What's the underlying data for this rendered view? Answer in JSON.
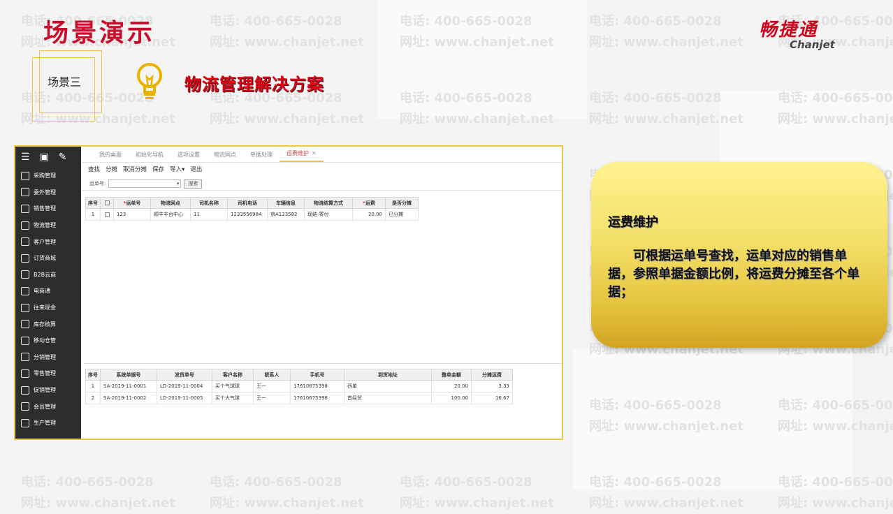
{
  "slide": {
    "title": "场景演示",
    "scene_label": "场景三",
    "subtitle": "物流管理解决方案"
  },
  "logo": {
    "cn": "畅捷通",
    "en": "Chanjet"
  },
  "watermark": {
    "phone": "电话: 400-665-0028",
    "web": "网址: www.chanjet.net"
  },
  "app": {
    "sidebar": {
      "top_icons": [
        "menu-icon",
        "document-icon",
        "edit-icon"
      ],
      "items": [
        {
          "label": "采购管理",
          "icon": "purchase-icon"
        },
        {
          "label": "委外管理",
          "icon": "outsource-icon"
        },
        {
          "label": "销售管理",
          "icon": "sales-icon"
        },
        {
          "label": "物流管理",
          "icon": "logistics-icon"
        },
        {
          "label": "客户管理",
          "icon": "customer-icon"
        },
        {
          "label": "订货商城",
          "icon": "mall-icon"
        },
        {
          "label": "B2B云商",
          "icon": "b2b-icon"
        },
        {
          "label": "电商通",
          "icon": "ecommerce-icon"
        },
        {
          "label": "往来现金",
          "icon": "cash-icon"
        },
        {
          "label": "库存核算",
          "icon": "inventory-icon"
        },
        {
          "label": "移动仓管",
          "icon": "warehouse-icon"
        },
        {
          "label": "分销管理",
          "icon": "distribution-icon"
        },
        {
          "label": "零售管理",
          "icon": "retail-icon"
        },
        {
          "label": "促销管理",
          "icon": "promotion-icon"
        },
        {
          "label": "会员管理",
          "icon": "member-icon"
        },
        {
          "label": "生产管理",
          "icon": "production-icon"
        }
      ]
    },
    "tabs": [
      {
        "label": "我的桌面",
        "active": false
      },
      {
        "label": "初始化导航",
        "active": false
      },
      {
        "label": "选项设置",
        "active": false
      },
      {
        "label": "物流网点",
        "active": false
      },
      {
        "label": "单据处理",
        "active": false
      },
      {
        "label": "运费维护",
        "active": true
      }
    ],
    "toolbar": [
      "查找",
      "分摊",
      "取消分摊",
      "保存",
      "导入",
      "退出"
    ],
    "search": {
      "label": "运单号:",
      "button": "搜索"
    },
    "top_table": {
      "headers": [
        "序号",
        "",
        "运单号",
        "物流网点",
        "司机名称",
        "司机电话",
        "车辆信息",
        "物流结算方式",
        "运费",
        "是否分摊"
      ],
      "required": [
        false,
        false,
        true,
        false,
        false,
        false,
        false,
        false,
        true,
        false
      ],
      "rows": [
        [
          "1",
          "",
          "123",
          "顺丰丰台中心",
          "11",
          "1233556984",
          "京A123582",
          "现结-寄付",
          "20.00",
          "已分摊"
        ]
      ]
    },
    "bottom_table": {
      "headers": [
        "序号",
        "系统单据号",
        "发货单号",
        "客户名称",
        "联系人",
        "手机号",
        "到货地址",
        "整单金额",
        "分摊运费"
      ],
      "rows": [
        [
          "1",
          "SA-2019-11-0001",
          "LD-2019-11-0004",
          "买个气球球",
          "王一",
          "17610675398",
          "西单",
          "20.00",
          "3.33"
        ],
        [
          "2",
          "SA-2019-11-0002",
          "LD-2019-11-0005",
          "买个大气球",
          "王一",
          "17610675398",
          "首经贸",
          "100.00",
          "16.67"
        ]
      ]
    }
  },
  "card": {
    "title": "运费维护",
    "body": "可根据运单号查找，运单对应的销售单据，参照单据金额比例，将运费分摊至各个单据；"
  },
  "colors": {
    "accent_red": "#c8102e",
    "frame_gold": "#e8c84a",
    "sidebar_dark": "#2d2d2d"
  }
}
